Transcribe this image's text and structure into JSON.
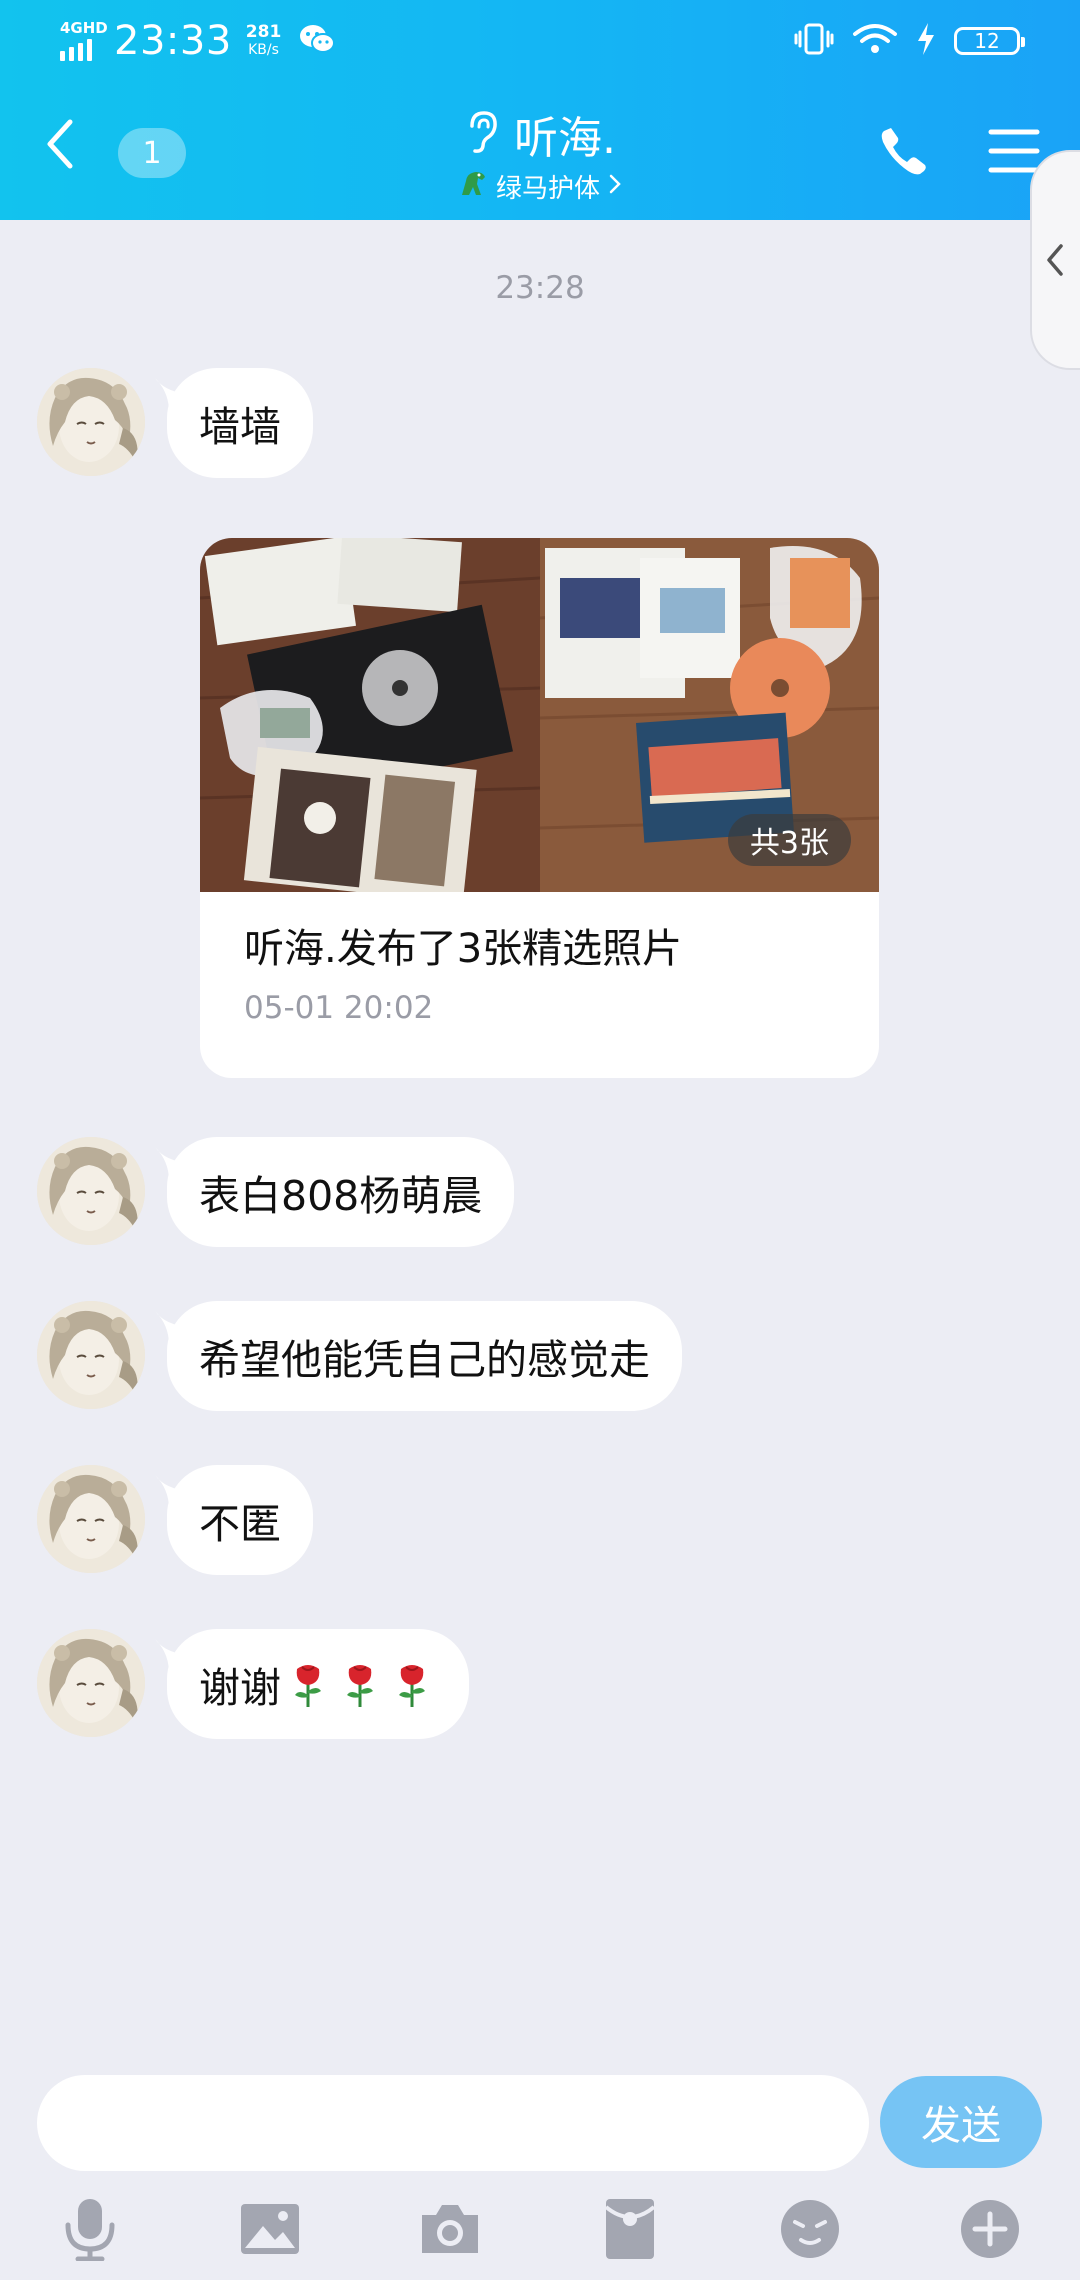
{
  "status_bar": {
    "network": "4GHD",
    "time": "23:33",
    "speed_value": "281",
    "speed_unit": "KB/s",
    "battery": "12"
  },
  "header": {
    "unread_count": "1",
    "contact_name": "听海.",
    "subtitle": "绿马护体"
  },
  "chat": {
    "timestamp": "23:28",
    "messages": [
      {
        "text": "墙墙"
      },
      {
        "text": "表白808杨萌晨"
      },
      {
        "text": "希望他能凭自己的感觉走"
      },
      {
        "text": "不匿"
      },
      {
        "text": "谢谢"
      }
    ],
    "photo_card": {
      "count_label": "共3张",
      "title": "听海.发布了3张精选照片",
      "time": "05-01 20:02"
    }
  },
  "input_bar": {
    "value": "",
    "send_label": "发送"
  },
  "colors": {
    "header_start": "#12c3ee",
    "header_end": "#1aa3f7",
    "chat_background": "#ecedf4",
    "send_button": "#76c4f4",
    "icon_gray": "#a3a6b1"
  },
  "icons": {
    "toolbar": [
      "microphone-icon",
      "image-icon",
      "camera-icon",
      "red-packet-icon",
      "emoji-icon",
      "plus-icon"
    ]
  }
}
